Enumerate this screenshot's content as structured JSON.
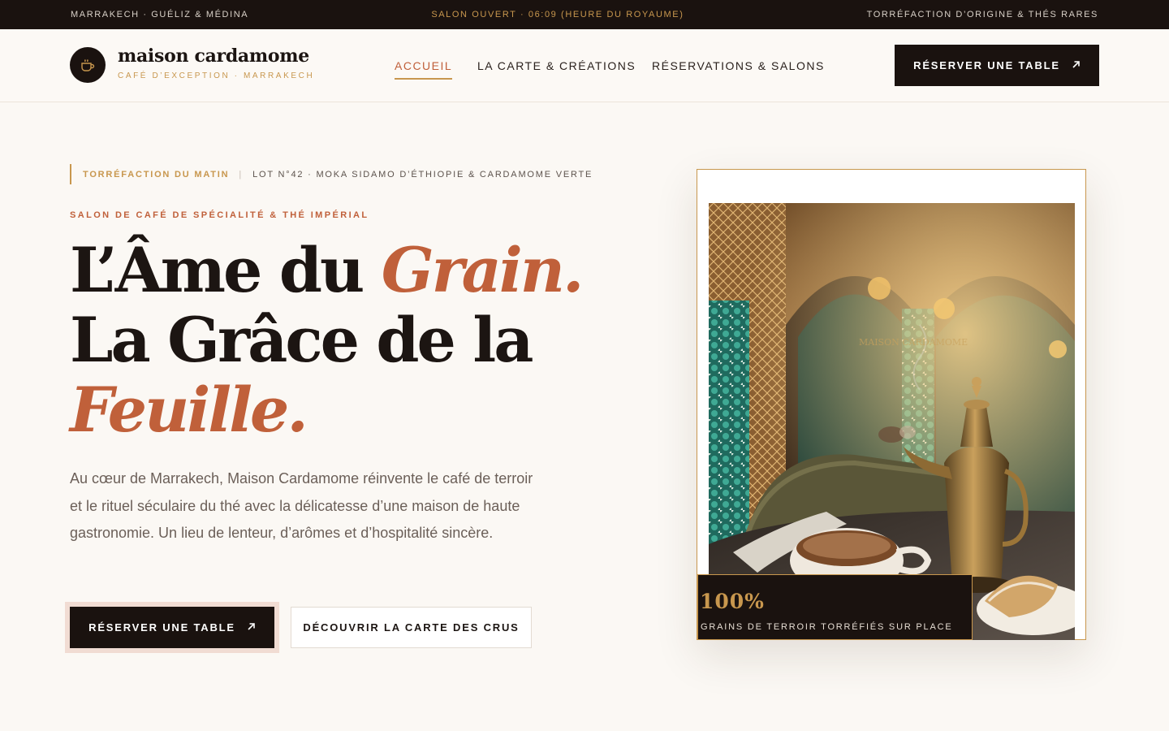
{
  "topbar": {
    "left": "Marrakech · Guéliz & Médina",
    "center": "Salon ouvert · 06:09 (heure du Royaume)",
    "right": "Torréfaction d’origine & thés rares"
  },
  "brand": {
    "name": "maison cardamome",
    "tagline": "Café d’exception · Marrakech",
    "logo_icon": "coffee-cup-icon"
  },
  "nav": {
    "links": [
      "Accueil",
      "La Carte & Créations",
      "Réservations & Salons"
    ],
    "active": "Accueil",
    "cta_label": "Réserver une table",
    "cta_icon": "arrow-up-right-icon"
  },
  "hero": {
    "kicker_label": "Torréfaction du matin",
    "kicker_sep": "|",
    "kicker_detail": "Lot N°42 · Moka Sidamo d’Éthiopie & Cardamome verte",
    "eyebrow": "Salon de café de spécialité & thé impérial",
    "headline": {
      "part1": "L’Âme du ",
      "accent1": "Grain.",
      "line2": "La Grâce de la",
      "accent2": "Feuille."
    },
    "lead": "Au cœur de Marrakech, Maison Cardamome réinvente le café de terroir et le rituel séculaire du thé avec la délicatesse d’une maison de haute gastronomie. Un lieu de lenteur, d’arômes et d’hospitalité sincère.",
    "cta_primary": "Réserver une table",
    "cta_secondary": "Découvrir la carte des crus"
  },
  "feature": {
    "stat_value": "100%",
    "stat_label": "Grains de terroir torréfiés sur place",
    "sign_text": "MAISON CARDAMOME"
  },
  "colors": {
    "ink": "#1a120f",
    "terracotta": "#c0603a",
    "gold": "#c8974e",
    "cream": "#fbf8f4"
  }
}
